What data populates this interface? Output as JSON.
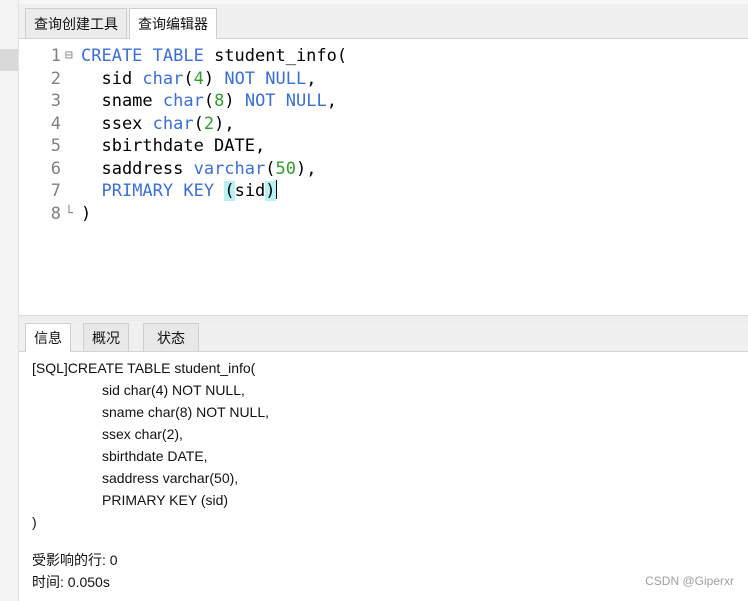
{
  "tabs": {
    "query_builder": "查询创建工具",
    "query_editor": "查询编辑器"
  },
  "editor": {
    "lines": [
      {
        "num": "1",
        "fold": "⊟",
        "tokens": [
          {
            "t": "CREATE TABLE",
            "c": "kw"
          },
          {
            "t": " student_info(",
            "c": ""
          }
        ]
      },
      {
        "num": "2",
        "fold": "",
        "tokens": [
          {
            "t": "  sid ",
            "c": ""
          },
          {
            "t": "char",
            "c": "kw"
          },
          {
            "t": "(",
            "c": ""
          },
          {
            "t": "4",
            "c": "num"
          },
          {
            "t": ") ",
            "c": ""
          },
          {
            "t": "NOT NULL",
            "c": "kw"
          },
          {
            "t": ",",
            "c": ""
          }
        ]
      },
      {
        "num": "3",
        "fold": "",
        "tokens": [
          {
            "t": "  sname ",
            "c": ""
          },
          {
            "t": "char",
            "c": "kw"
          },
          {
            "t": "(",
            "c": ""
          },
          {
            "t": "8",
            "c": "num"
          },
          {
            "t": ") ",
            "c": ""
          },
          {
            "t": "NOT NULL",
            "c": "kw"
          },
          {
            "t": ",",
            "c": ""
          }
        ]
      },
      {
        "num": "4",
        "fold": "",
        "tokens": [
          {
            "t": "  ssex ",
            "c": ""
          },
          {
            "t": "char",
            "c": "kw"
          },
          {
            "t": "(",
            "c": ""
          },
          {
            "t": "2",
            "c": "num"
          },
          {
            "t": "),",
            "c": ""
          }
        ]
      },
      {
        "num": "5",
        "fold": "",
        "tokens": [
          {
            "t": "  sbirthdate DATE,",
            "c": ""
          }
        ]
      },
      {
        "num": "6",
        "fold": "",
        "tokens": [
          {
            "t": "  saddress ",
            "c": ""
          },
          {
            "t": "varchar",
            "c": "kw"
          },
          {
            "t": "(",
            "c": ""
          },
          {
            "t": "50",
            "c": "num"
          },
          {
            "t": "),",
            "c": ""
          }
        ]
      },
      {
        "num": "7",
        "fold": "",
        "tokens": [
          {
            "t": "  ",
            "c": ""
          },
          {
            "t": "PRIMARY KEY",
            "c": "kw"
          },
          {
            "t": " ",
            "c": ""
          },
          {
            "t": "(",
            "c": "hl"
          },
          {
            "t": "sid",
            "c": ""
          },
          {
            "t": ")",
            "c": "hl"
          },
          {
            "t": "|",
            "c": "caret"
          }
        ]
      },
      {
        "num": "8",
        "fold": "└",
        "tokens": [
          {
            "t": ")",
            "c": ""
          }
        ]
      }
    ]
  },
  "bottom_tabs": {
    "info": "信息",
    "overview": "概况",
    "status": "状态"
  },
  "info": {
    "sql_lines": [
      "[SQL]CREATE TABLE student_info(",
      "sid char(4) NOT NULL,",
      "sname char(8) NOT NULL,",
      "ssex char(2),",
      "sbirthdate DATE,",
      "saddress varchar(50),",
      "PRIMARY KEY (sid)",
      ")"
    ],
    "affected_rows": "受影响的行: 0",
    "time": "时间: 0.050s"
  },
  "watermark": "CSDN @Giperxr",
  "colors": {
    "keyword": "#3a6fd8",
    "number": "#2e9e2e",
    "bracket_highlight": "#b8f0f4"
  }
}
